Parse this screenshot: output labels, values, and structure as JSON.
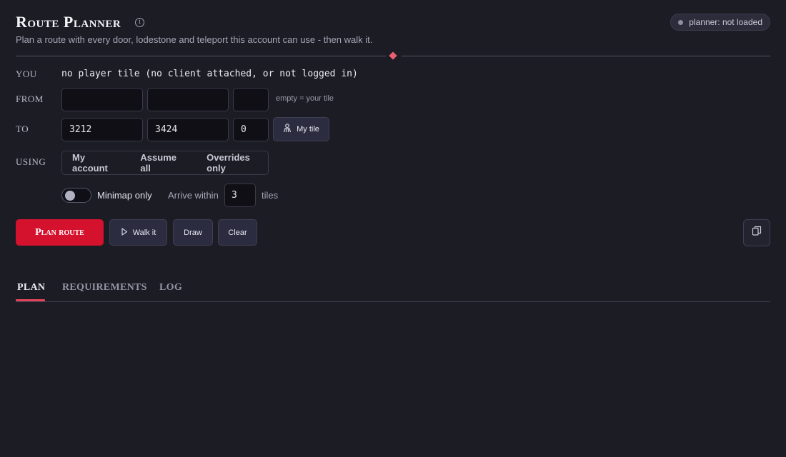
{
  "header": {
    "title": "Route Planner",
    "info_glyph": "i",
    "subtitle": "Plan a route with every door, lodestone and teleport this account can use - then walk it.",
    "status": "planner: not loaded"
  },
  "form": {
    "you": {
      "label": "YOU",
      "value": "no player tile (no client attached, or not logged in)"
    },
    "from": {
      "label": "FROM",
      "x": "",
      "y": "",
      "plane": "",
      "hint": "empty = your tile"
    },
    "to": {
      "label": "TO",
      "x": "3212",
      "y": "3424",
      "plane": "0",
      "my_tile_label": "My tile"
    },
    "using": {
      "label": "USING",
      "options": [
        "My account",
        "Assume all",
        "Overrides only"
      ]
    },
    "minimap_only": {
      "label": "Minimap only",
      "enabled": false
    },
    "arrive_within": {
      "label": "Arrive within",
      "value": "3",
      "unit": "tiles"
    }
  },
  "actions": {
    "plan_route": "Plan route",
    "walk_it": "Walk it",
    "draw": "Draw",
    "clear": "Clear"
  },
  "tabs": [
    "Plan",
    "Requirements",
    "Log"
  ],
  "colors": {
    "background": "#1c1c24",
    "accent": "#d4122e",
    "tab_underline": "#e2445a",
    "status_dot": "#8e8ea0"
  },
  "icons": {
    "info": "info-icon",
    "status": "status-dot",
    "my_tile": "person-icon",
    "walk": "play-icon",
    "copy": "copy-icon"
  }
}
